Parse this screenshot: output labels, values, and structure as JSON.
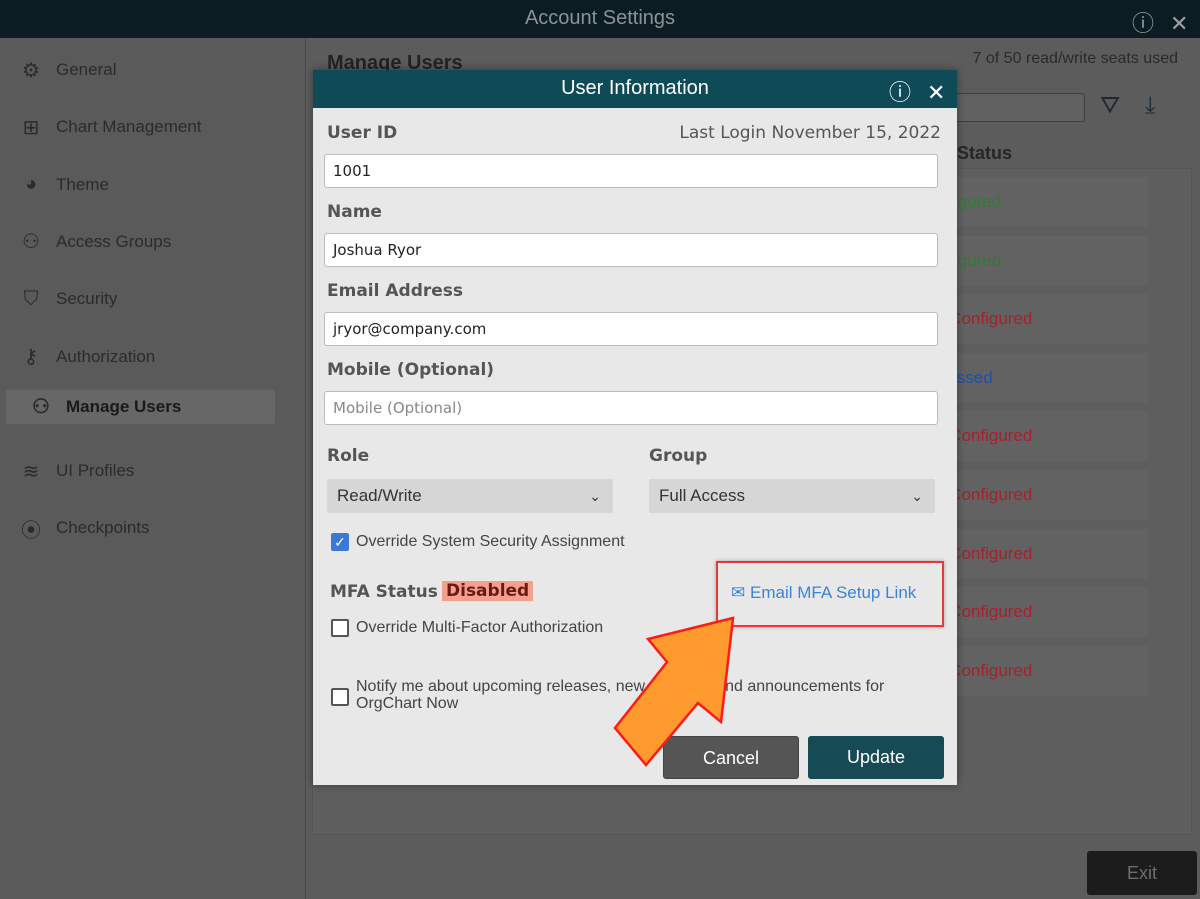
{
  "app": {
    "title": "Account Settings"
  },
  "sidebar": {
    "items": [
      {
        "label": "General",
        "icon": "gear-icon",
        "glyph": "⚙"
      },
      {
        "label": "Chart Management",
        "icon": "org-chart-icon",
        "glyph": "⊞"
      },
      {
        "label": "Theme",
        "icon": "palette-icon",
        "glyph": "◕"
      },
      {
        "label": "Access Groups",
        "icon": "users-group-icon",
        "glyph": "⚇"
      },
      {
        "label": "Security",
        "icon": "shield-icon",
        "glyph": "⛉"
      },
      {
        "label": "Authorization",
        "icon": "key-icon",
        "glyph": "⚷"
      },
      {
        "label": "Manage Users",
        "icon": "users-icon",
        "glyph": "⚇",
        "selected": true
      },
      {
        "label": "UI Profiles",
        "icon": "layers-icon",
        "glyph": "≋"
      },
      {
        "label": "Checkpoints",
        "icon": "location-pin-icon",
        "glyph": "⦿"
      }
    ]
  },
  "main": {
    "title": "Manage Users",
    "seats": "7 of 50 read/write seats used",
    "status_header": "Status",
    "rows": [
      {
        "status": "Configured",
        "color": "#2e7d32"
      },
      {
        "status": "Configured",
        "color": "#2e7d32"
      },
      {
        "status": "Not Configured",
        "color": "#a3222d"
      },
      {
        "status": "Bypassed",
        "color": "#1f4fa8"
      },
      {
        "status": "Not Configured",
        "color": "#a3222d"
      },
      {
        "status": "Not Configured",
        "color": "#a3222d"
      },
      {
        "status": "Not Configured",
        "color": "#a3222d"
      },
      {
        "status": "Not Configured",
        "color": "#a3222d"
      },
      {
        "status": "Not Configured",
        "color": "#a3222d"
      }
    ],
    "exit": "Exit"
  },
  "modal": {
    "title": "User Information",
    "user_id_label": "User ID",
    "last_login": "Last Login November 15, 2022",
    "user_id": "1001",
    "name_label": "Name",
    "name": "Joshua Ryor",
    "email_label": "Email Address",
    "email": "jryor@company.com",
    "mobile_label": "Mobile (Optional)",
    "mobile_placeholder": "Mobile (Optional)",
    "role_label": "Role",
    "role": "Read/Write",
    "group_label": "Group",
    "group": "Full Access",
    "override_security": "Override System Security Assignment",
    "override_security_checked": true,
    "mfa_label": "MFA Status",
    "mfa_status": "Disabled",
    "email_mfa_link": "Email MFA Setup Link",
    "override_mfa": "Override Multi-Factor Authorization",
    "override_mfa_checked": false,
    "notify": "Notify me about upcoming releases, new features, and announcements for OrgChart Now",
    "notify_checked": false,
    "cancel": "Cancel",
    "update": "Update"
  },
  "colors": {
    "header": "#0f4a57",
    "accent": "#3b78d8",
    "highlight": "#e53935",
    "arrow": "#ff9a2e"
  }
}
